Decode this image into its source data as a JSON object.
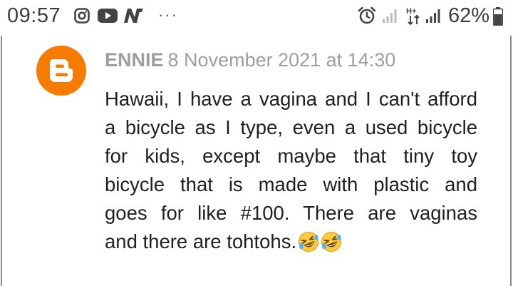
{
  "status_bar": {
    "time": "09:57",
    "notification_icons": [
      "instagram-icon",
      "youtube-icon",
      "n-app-icon"
    ],
    "overflow": "···",
    "system_icons": [
      "alarm-icon",
      "signal-icon",
      "hplus-data-icon",
      "signal-icon"
    ],
    "network_label": "H+",
    "battery_percent": "62%"
  },
  "comment": {
    "avatar_icon": "blogger-icon",
    "author": "ENNIE",
    "timestamp": "8 November 2021 at 14:30",
    "body_lines": [
      "Hawaii, I have a vagina and I can't afford",
      "a bicycle as I type, even a used bicycle",
      "for kids, except maybe that tiny toy",
      "bicycle that is made with plastic and",
      "goes for like #100. There are vaginas",
      "and there are tohtohs."
    ],
    "emojis": [
      "rolling-on-floor-laughing-emoji",
      "rolling-on-floor-laughing-emoji"
    ]
  },
  "colors": {
    "avatar_orange": "#F57C00",
    "author_gray": "#9E9E9E",
    "body_text": "#1F1F1F",
    "status_text": "#3D3D3D"
  }
}
